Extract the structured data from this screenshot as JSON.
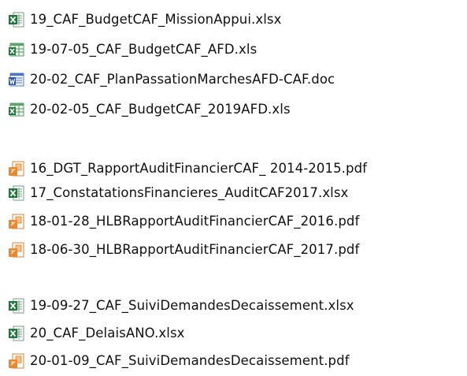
{
  "groups": [
    {
      "files": [
        {
          "name": "19_CAF_BudgetCAF_MissionAppui.xlsx",
          "icon": "excel-file-icon"
        },
        {
          "name": "19-07-05_CAF_BudgetCAF_AFD.xls",
          "icon": "excel-file-icon"
        },
        {
          "name": "20-02_CAF_PlanPassationMarchesAFD-CAF.doc",
          "icon": "word-file-icon"
        },
        {
          "name": "20-02-05_CAF_BudgetCAF_2019AFD.xls",
          "icon": "excel-file-icon"
        }
      ]
    },
    {
      "files": [
        {
          "name": "16_DGT_RapportAuditFinancierCAF_ 2014-2015.pdf",
          "icon": "pdf-file-icon"
        },
        {
          "name": "17_ConstatationsFinancieres_AuditCAF2017.xlsx",
          "icon": "excel-file-icon"
        },
        {
          "name": "18-01-28_HLBRapportAuditFinancierCAF_2016.pdf",
          "icon": "pdf-file-icon"
        },
        {
          "name": "18-06-30_HLBRapportAuditFinancierCAF_2017.pdf",
          "icon": "pdf-file-icon"
        }
      ]
    },
    {
      "files": [
        {
          "name": "19-09-27_CAF_SuiviDemandesDecaissement.xlsx",
          "icon": "excel-file-icon"
        },
        {
          "name": "20_CAF_DelaisANO.xlsx",
          "icon": "excel-file-icon"
        },
        {
          "name": "20-01-09_CAF_SuiviDemandesDecaissement.pdf",
          "icon": "pdf-file-icon"
        }
      ]
    }
  ],
  "icon_colors": {
    "excel": "#1f7a3a",
    "word": "#2b5aa8",
    "pdf": "#d9822b"
  }
}
